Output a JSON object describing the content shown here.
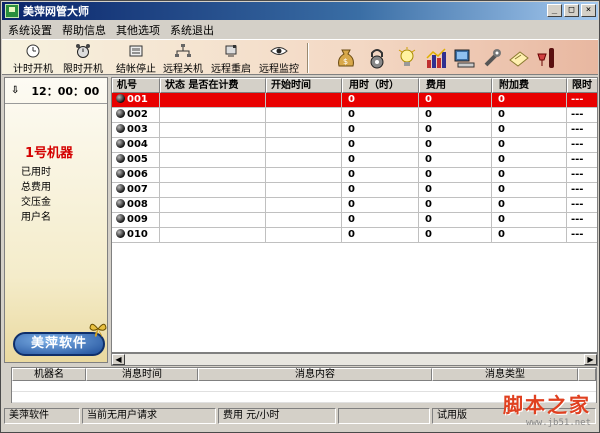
{
  "window": {
    "title": "美萍网管大师",
    "controls": [
      "_",
      "□",
      "×"
    ]
  },
  "menu": [
    "系统设置",
    "帮助信息",
    "其他选项",
    "系统退出"
  ],
  "toolbar": {
    "buttons": [
      {
        "label": "计时开机",
        "icon": "clock-icon"
      },
      {
        "label": "限时开机",
        "icon": "alarm-clock-icon"
      },
      {
        "label": "结帐停止",
        "icon": "cash-register-icon"
      },
      {
        "label": "远程关机",
        "icon": "network-icon"
      },
      {
        "label": "远程重启",
        "icon": "restart-icon"
      },
      {
        "label": "远程监控",
        "icon": "eye-icon"
      }
    ],
    "tools": [
      "money-bag-icon",
      "lock-icon",
      "bulb-icon",
      "bar-chart-icon",
      "computer-icon",
      "wrench-icon",
      "notepad-icon",
      "wine-icon"
    ]
  },
  "left_panel": {
    "clock": "12：00：00",
    "machine_title": "1号机器",
    "info": [
      "已用时",
      "总费用",
      "交压金",
      "用户名"
    ],
    "brand": "美萍软件"
  },
  "grid": {
    "columns": [
      "机号",
      "状态  是否在计费",
      "开始时间",
      "用时（时）",
      "费用",
      "附加费",
      "限时"
    ],
    "rows": [
      {
        "id": "001",
        "status": "",
        "start": "",
        "hours": "0",
        "fee": "0",
        "extra": "0",
        "limit": "---"
      },
      {
        "id": "002",
        "status": "",
        "start": "",
        "hours": "0",
        "fee": "0",
        "extra": "0",
        "limit": "---"
      },
      {
        "id": "003",
        "status": "",
        "start": "",
        "hours": "0",
        "fee": "0",
        "extra": "0",
        "limit": "---"
      },
      {
        "id": "004",
        "status": "",
        "start": "",
        "hours": "0",
        "fee": "0",
        "extra": "0",
        "limit": "---"
      },
      {
        "id": "005",
        "status": "",
        "start": "",
        "hours": "0",
        "fee": "0",
        "extra": "0",
        "limit": "---"
      },
      {
        "id": "006",
        "status": "",
        "start": "",
        "hours": "0",
        "fee": "0",
        "extra": "0",
        "limit": "---"
      },
      {
        "id": "007",
        "status": "",
        "start": "",
        "hours": "0",
        "fee": "0",
        "extra": "0",
        "limit": "---"
      },
      {
        "id": "008",
        "status": "",
        "start": "",
        "hours": "0",
        "fee": "0",
        "extra": "0",
        "limit": "---"
      },
      {
        "id": "009",
        "status": "",
        "start": "",
        "hours": "0",
        "fee": "0",
        "extra": "0",
        "limit": "---"
      },
      {
        "id": "010",
        "status": "",
        "start": "",
        "hours": "0",
        "fee": "0",
        "extra": "0",
        "limit": "---"
      }
    ],
    "selected_row": 0
  },
  "messages": {
    "columns": [
      "机器名",
      "消息时间",
      "消息内容",
      "消息类型"
    ]
  },
  "status": [
    "美萍软件",
    "当前无用户请求",
    "费用   元/小时",
    "",
    "试用版"
  ],
  "watermark": {
    "main": "脚本之家",
    "url": "www.jb51.net"
  },
  "colors": {
    "selected_row": "#e80000",
    "machine_title": "#d40000",
    "title_bar": "#0a246a"
  }
}
